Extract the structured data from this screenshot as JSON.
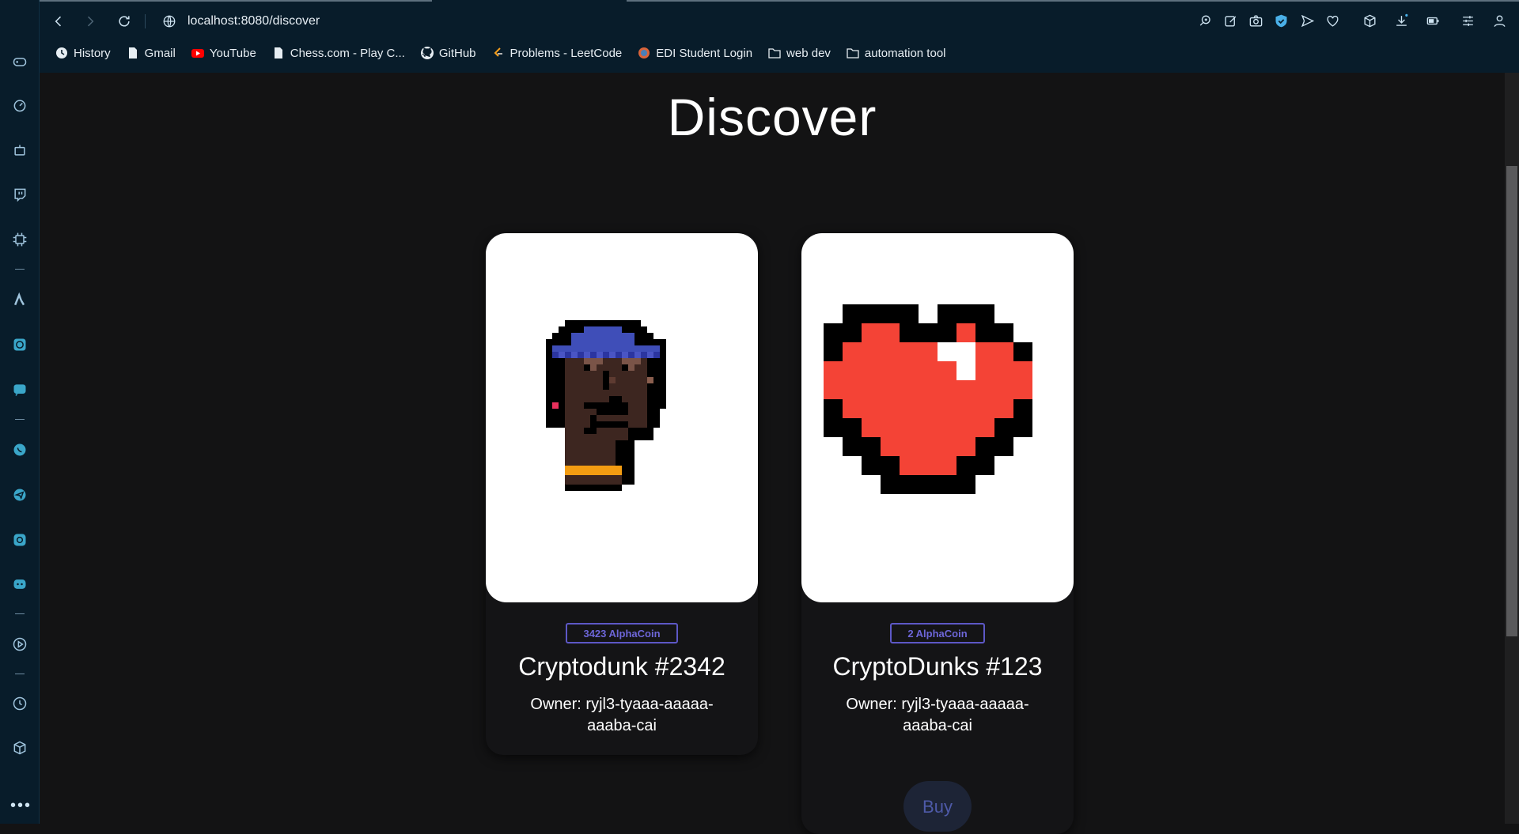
{
  "browser": {
    "url": "localhost:8080/discover",
    "bookmarks": [
      {
        "label": "History",
        "icon": "clock-icon"
      },
      {
        "label": "Gmail",
        "icon": "document-icon"
      },
      {
        "label": "YouTube",
        "icon": "youtube-icon"
      },
      {
        "label": "Chess.com - Play C...",
        "icon": "document-icon"
      },
      {
        "label": "GitHub",
        "icon": "github-icon"
      },
      {
        "label": "Problems - LeetCode",
        "icon": "leetcode-icon"
      },
      {
        "label": "EDI Student Login",
        "icon": "edi-icon"
      },
      {
        "label": "web dev",
        "icon": "folder-icon"
      },
      {
        "label": "automation tool",
        "icon": "folder-icon"
      }
    ]
  },
  "page": {
    "title": "Discover"
  },
  "cards": [
    {
      "price": "3423 AlphaCoin",
      "name": "Cryptodunk #2342",
      "owner": "Owner: ryjl3-tyaaa-aaaaa-aaaba-cai",
      "image": "punk-avatar"
    },
    {
      "price": "2 AlphaCoin",
      "name": "CryptoDunks #123",
      "owner": "Owner: ryjl3-tyaaa-aaaaa-aaaba-cai",
      "image": "pixel-heart"
    }
  ],
  "buy_label": "Buy",
  "colors": {
    "chrome": "#081c2a",
    "page_bg": "#131314",
    "accent": "#5d58c6",
    "heart_red": "#f44336",
    "beanie_blue": "#3f4eb8"
  }
}
